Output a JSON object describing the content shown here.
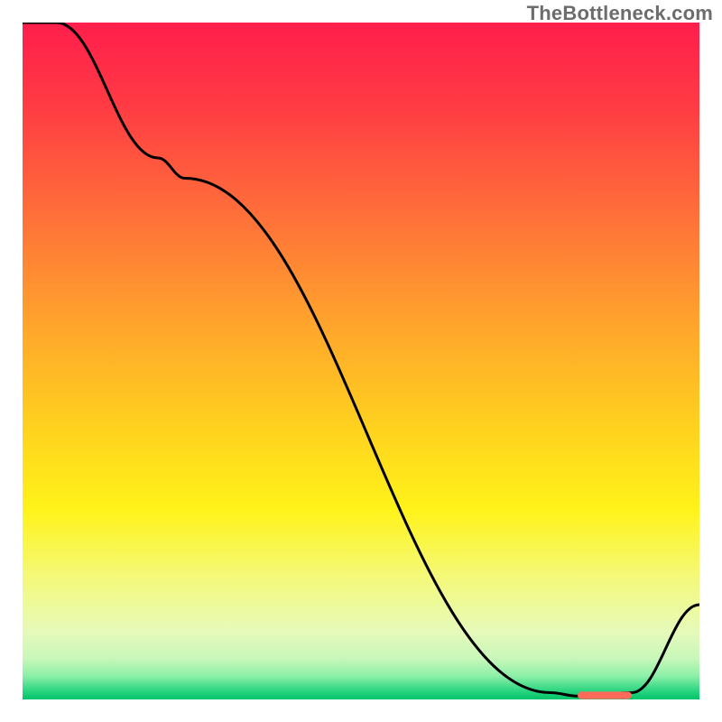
{
  "watermark": "TheBottleneck.com",
  "chart_data": {
    "type": "line",
    "title": "",
    "xlabel": "",
    "ylabel": "",
    "xlim": [
      0,
      100
    ],
    "ylim": [
      0,
      100
    ],
    "x": [
      0,
      5,
      20,
      24,
      78,
      82,
      90,
      100
    ],
    "values": [
      100,
      100,
      80,
      77,
      1,
      0.5,
      1,
      14
    ],
    "marker": {
      "x_range": [
        82,
        90
      ],
      "y": 0.6,
      "color": "#ff6a5a",
      "thickness": 1.1
    },
    "gradient_stops": [
      {
        "offset": 0,
        "color": "#ff1e4c"
      },
      {
        "offset": 0.12,
        "color": "#ff3a44"
      },
      {
        "offset": 0.28,
        "color": "#ff6e3a"
      },
      {
        "offset": 0.45,
        "color": "#ffa62c"
      },
      {
        "offset": 0.6,
        "color": "#ffd21e"
      },
      {
        "offset": 0.72,
        "color": "#fff31a"
      },
      {
        "offset": 0.82,
        "color": "#f4f97a"
      },
      {
        "offset": 0.9,
        "color": "#e6faba"
      },
      {
        "offset": 0.94,
        "color": "#c7f7b9"
      },
      {
        "offset": 0.965,
        "color": "#8ef0a8"
      },
      {
        "offset": 0.985,
        "color": "#34d884"
      },
      {
        "offset": 1.0,
        "color": "#00c46a"
      }
    ]
  }
}
